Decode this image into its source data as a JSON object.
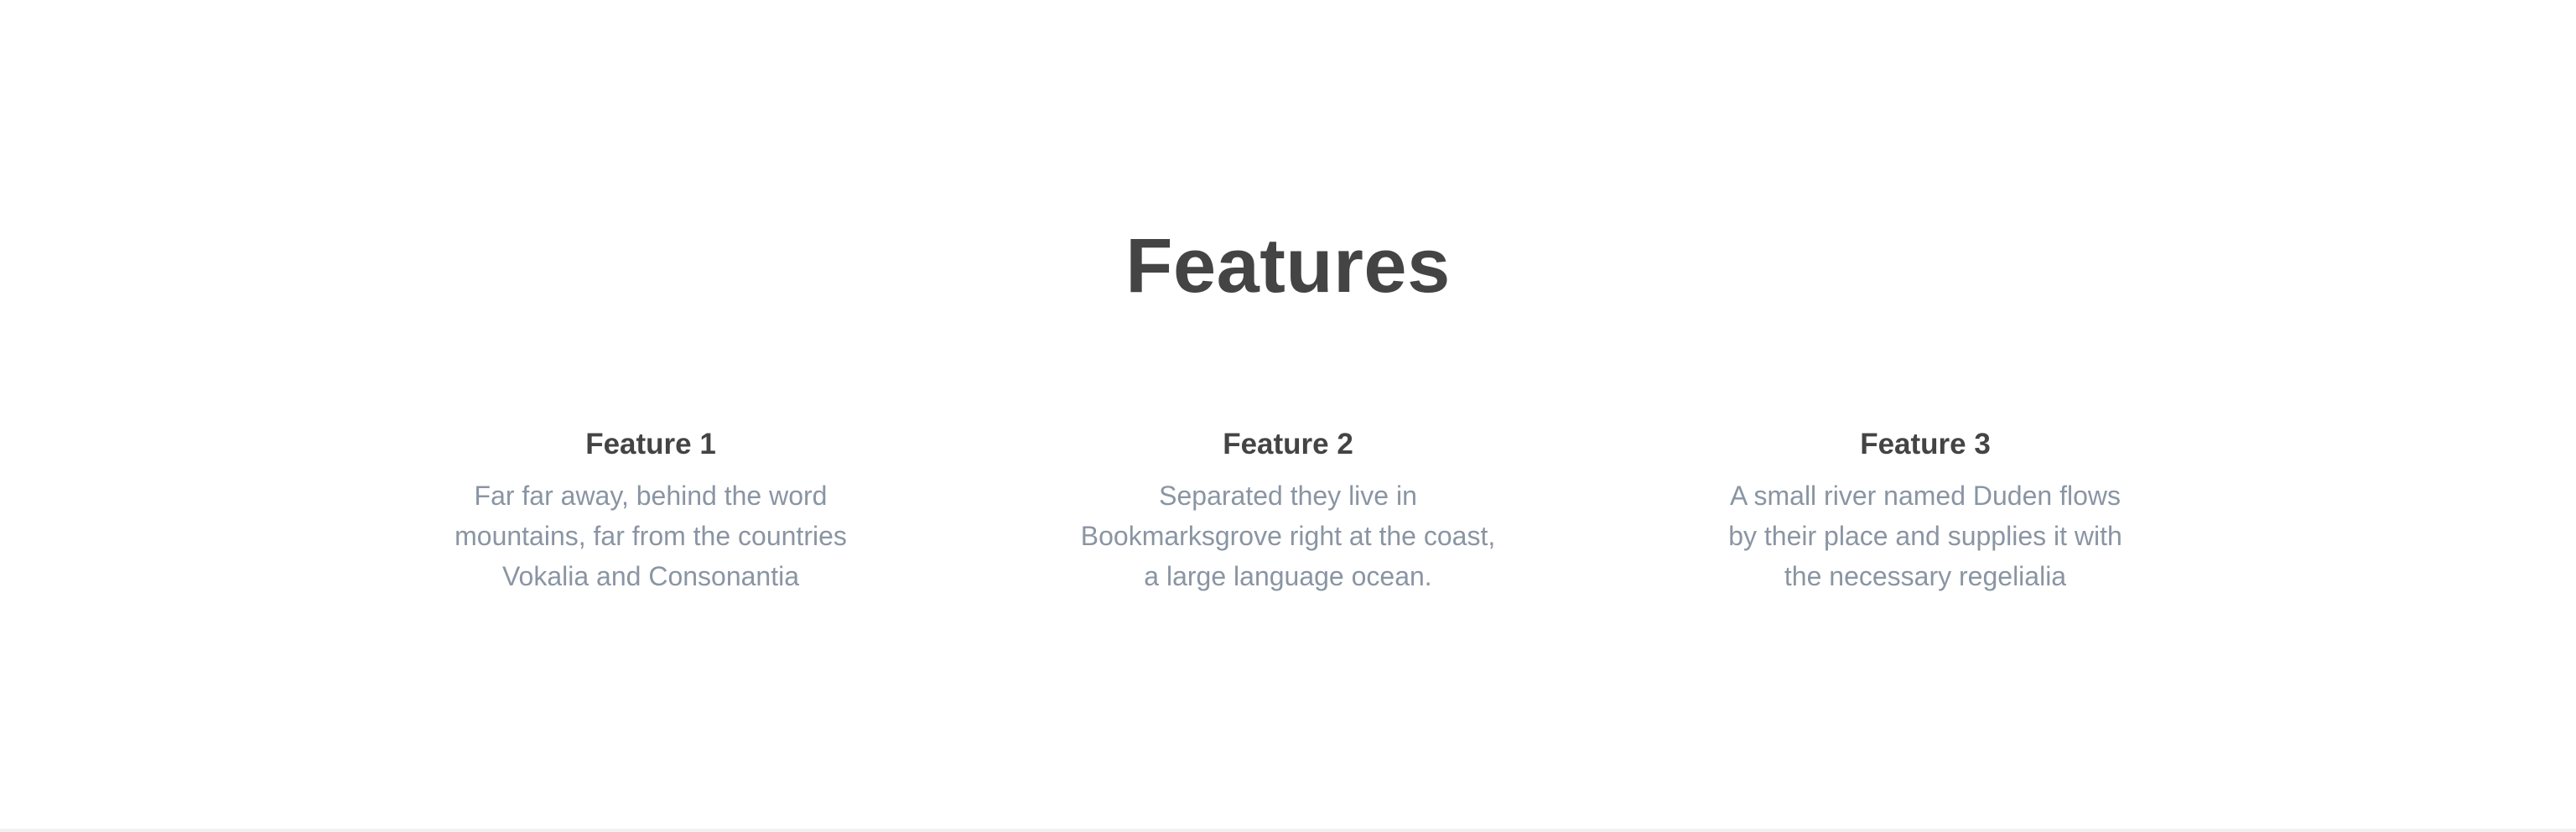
{
  "features_section": {
    "title": "Features",
    "items": [
      {
        "heading": "Feature 1",
        "text": "Far far away, behind the word mountains, far from the countries Vokalia and Consonantia"
      },
      {
        "heading": "Feature 2",
        "text": "Separated they live in Bookmarksgrove right at the coast, a large language ocean."
      },
      {
        "heading": "Feature 3",
        "text": "A small river named Duden flows by their place and supplies it with the necessary regelialia"
      }
    ]
  },
  "colors": {
    "heading": "#444444",
    "body_text": "#8a95a3",
    "background": "#ffffff",
    "divider": "#f1f1f1"
  }
}
